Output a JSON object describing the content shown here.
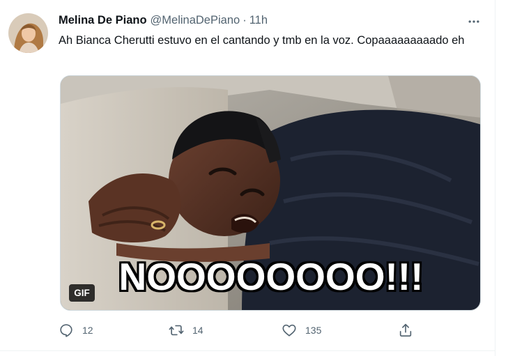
{
  "tweet": {
    "display_name": "Melina De Piano",
    "handle": "@MelinaDePiano",
    "separator": "·",
    "time": "11h",
    "text": "Ah Bianca Cherutti estuvo en el cantando y tmb en la voz. Copaaaaaaaaado eh",
    "media": {
      "caption": "NOOOOOOOO!!!",
      "badge": "GIF"
    },
    "actions": {
      "reply_count": "12",
      "retweet_count": "14",
      "like_count": "135"
    }
  },
  "icons": {
    "avatar": "avatar-photo",
    "more": "more-horizontal-icon",
    "reply": "reply-icon",
    "retweet": "retweet-icon",
    "like": "heart-icon",
    "share": "share-icon"
  },
  "colors": {
    "text_primary": "#0f1419",
    "text_secondary": "#536471",
    "border": "#cfd9de"
  }
}
